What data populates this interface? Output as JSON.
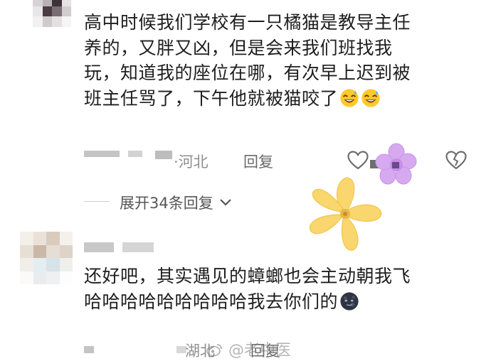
{
  "comment1": {
    "lines": [
      "高中时候我们学校有一只橘猫是教导主任",
      "养的，又胖又凶，但是会来我们班找我",
      "玩，知道我的座位在哪，有次早上迟到被",
      "班主任骂了，下午他就被猫咬了"
    ],
    "location": "河北",
    "reply_label": "回复",
    "dot": "·",
    "emoji": [
      "grinning-sweat-emoji",
      "grinning-sweat-emoji"
    ]
  },
  "expand_label": "展开34条回复",
  "comment2": {
    "lines": [
      "还好吧，其实遇见的蟑螂也会主动朝我飞",
      "哈哈哈哈哈哈哈哈哈我去你们的"
    ],
    "location": "湖北",
    "reply_label": "回复",
    "dot": "·",
    "emoji": [
      "new-moon-face-emoji"
    ]
  },
  "watermark": "@老中医",
  "icons": [
    "heart-icon",
    "broken-heart-icon",
    "chevron-down-icon",
    "weibo-icon"
  ],
  "stickers": [
    "purple-flower-sticker",
    "yellow-flower-sticker"
  ]
}
